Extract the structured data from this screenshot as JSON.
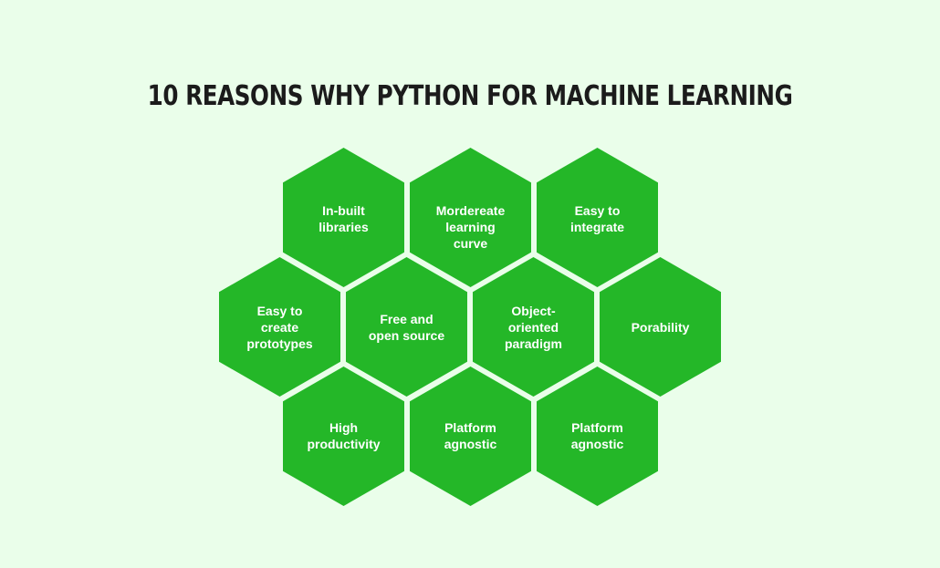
{
  "title": "10 REASONS WHY PYTHON FOR MACHINE LEARNING",
  "colors": {
    "background": "#eafeea",
    "hexagon": "#24b728",
    "hexagon_text": "#ffffff",
    "title": "#1b1b1b"
  },
  "hexagons": [
    {
      "label": "In-built\nlibraries"
    },
    {
      "label": "Mordereate\nlearning\ncurve"
    },
    {
      "label": "Easy to\nintegrate"
    },
    {
      "label": "Easy to\ncreate\nprototypes"
    },
    {
      "label": "Free and\nopen source"
    },
    {
      "label": "Object-\noriented\nparadigm"
    },
    {
      "label": "Porability"
    },
    {
      "label": "High\nproductivity"
    },
    {
      "label": "Platform\nagnostic"
    },
    {
      "label": "Platform\nagnostic"
    }
  ]
}
